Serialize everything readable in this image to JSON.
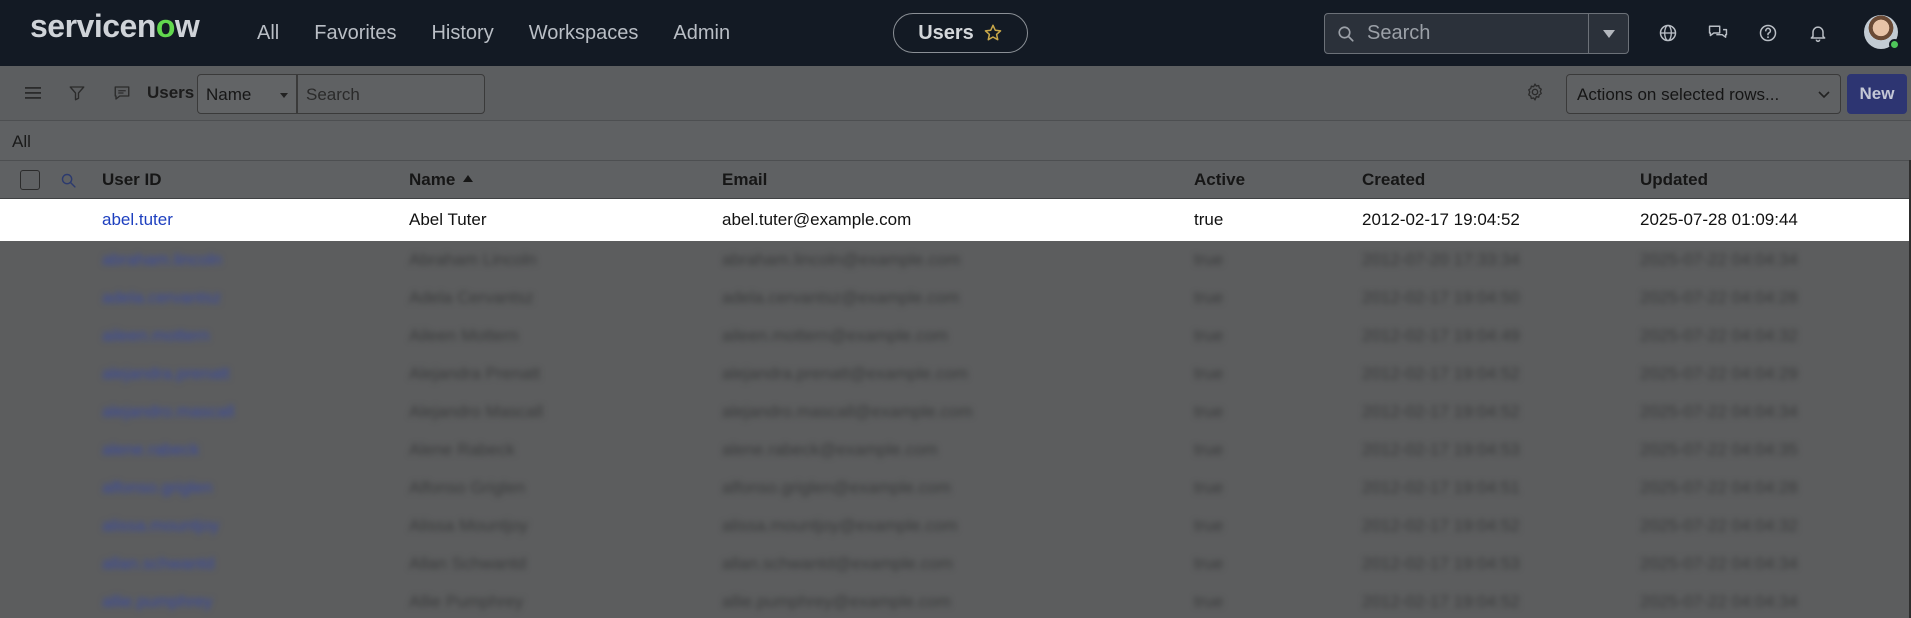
{
  "topnav": {
    "logo": "servicenow",
    "links": [
      "All",
      "Favorites",
      "History",
      "Workspaces",
      "Admin"
    ],
    "app_title": "Users",
    "search_placeholder": "Search",
    "icons": [
      "globe-icon",
      "chat-icon",
      "help-icon",
      "bell-icon"
    ]
  },
  "toolbar": {
    "icons": [
      "hamburger-icon",
      "filter-icon",
      "comment-icon"
    ],
    "title": "Users",
    "field_select": "Name",
    "search_placeholder": "Search",
    "gear_icon": "gear-icon",
    "actions_label": "Actions on selected rows...",
    "new_label": "New"
  },
  "breadcrumb": "All",
  "table": {
    "columns": [
      "User ID",
      "Name",
      "Email",
      "Active",
      "Created",
      "Updated"
    ],
    "sort_column": "Name",
    "sort_direction": "ascending",
    "rows": [
      {
        "user_id": "abel.tuter",
        "name": "Abel Tuter",
        "email": "abel.tuter@example.com",
        "active": "true",
        "created": "2012-02-17 19:04:52",
        "updated": "2025-07-28 01:09:44"
      },
      {
        "user_id": "abraham.lincoln",
        "name": "Abraham Lincoln",
        "email": "abraham.lincoln@example.com",
        "active": "true",
        "created": "2012-07-20 17:33:34",
        "updated": "2025-07-22 04:04:34"
      },
      {
        "user_id": "adela.cervantsz",
        "name": "Adela Cervantsz",
        "email": "adela.cervantsz@example.com",
        "active": "true",
        "created": "2012-02-17 19:04:50",
        "updated": "2025-07-22 04:04:28"
      },
      {
        "user_id": "aileen.mottern",
        "name": "Aileen Mottern",
        "email": "aileen.mottern@example.com",
        "active": "true",
        "created": "2012-02-17 19:04:49",
        "updated": "2025-07-22 04:04:32"
      },
      {
        "user_id": "alejandra.prenatt",
        "name": "Alejandra Prenatt",
        "email": "alejandra.prenatt@example.com",
        "active": "true",
        "created": "2012-02-17 19:04:52",
        "updated": "2025-07-22 04:04:29"
      },
      {
        "user_id": "alejandro.mascall",
        "name": "Alejandro Mascall",
        "email": "alejandro.mascall@example.com",
        "active": "true",
        "created": "2012-02-17 19:04:52",
        "updated": "2025-07-22 04:04:34"
      },
      {
        "user_id": "alene.rabeck",
        "name": "Alene Rabeck",
        "email": "alene.rabeck@example.com",
        "active": "true",
        "created": "2012-02-17 19:04:53",
        "updated": "2025-07-22 04:04:35"
      },
      {
        "user_id": "alfonso.griglen",
        "name": "Alfonso Griglen",
        "email": "alfonso.griglen@example.com",
        "active": "true",
        "created": "2012-02-17 19:04:51",
        "updated": "2025-07-22 04:04:28"
      },
      {
        "user_id": "alissa.mountjoy",
        "name": "Alissa Mountjoy",
        "email": "alissa.mountjoy@example.com",
        "active": "true",
        "created": "2012-02-17 19:04:52",
        "updated": "2025-07-22 04:04:32"
      },
      {
        "user_id": "allan.schwantd",
        "name": "Allan Schwantd",
        "email": "allan.schwantd@example.com",
        "active": "true",
        "created": "2012-02-17 19:04:53",
        "updated": "2025-07-22 04:04:34"
      },
      {
        "user_id": "allie.pumphrey",
        "name": "Allie Pumphrey",
        "email": "allie.pumphrey@example.com",
        "active": "true",
        "created": "2012-02-17 19:04:52",
        "updated": "2025-07-22 04:04:34"
      }
    ]
  },
  "colors": {
    "nav_bg": "#131a24",
    "accent_new": "#2d3572",
    "link": "#1d3fbf",
    "logo_green": "#62d84e"
  }
}
